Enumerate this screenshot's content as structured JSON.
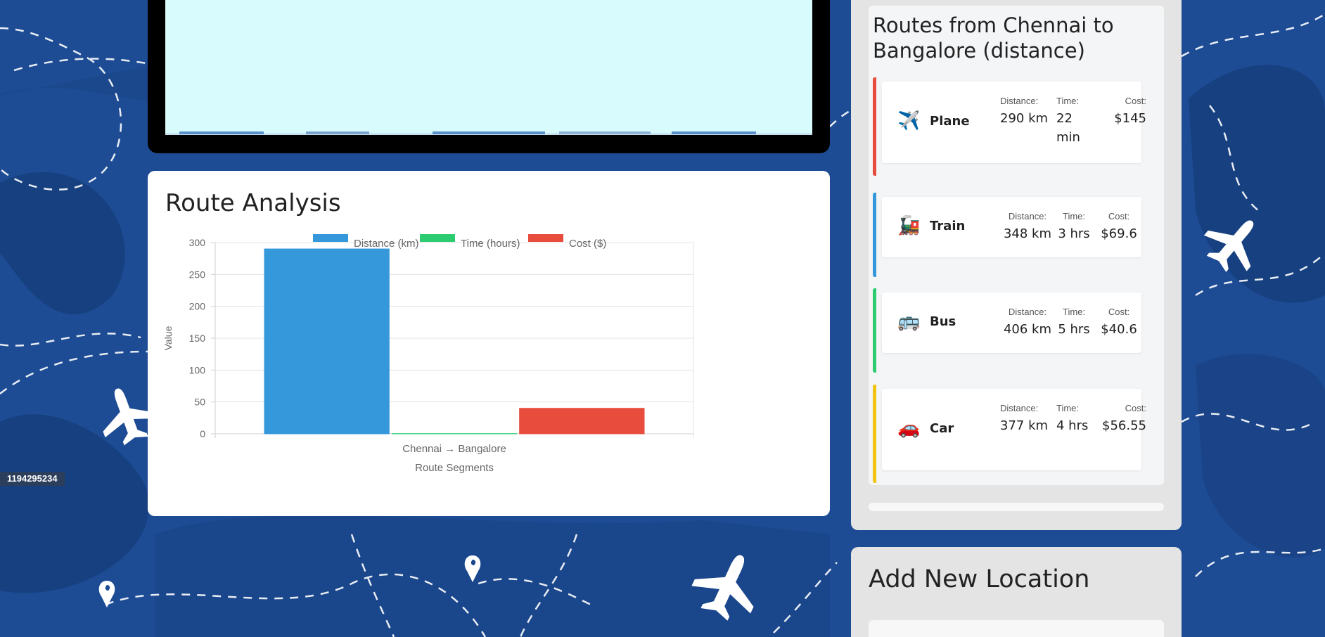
{
  "colors": {
    "background": "#1d4c94",
    "plane": "#e74c3c",
    "train": "#3498db",
    "bus": "#2ecc71",
    "car": "#f1c40f"
  },
  "image_id": "1194295234",
  "analysis": {
    "title": "Route Analysis"
  },
  "chart_data": {
    "type": "bar",
    "categories": [
      "Chennai → Bangalore"
    ],
    "series": [
      {
        "name": "Distance (km)",
        "values": [
          290
        ],
        "color": "#3498db"
      },
      {
        "name": "Time (hours)",
        "values": [
          0.37
        ],
        "color": "#2ecc71"
      },
      {
        "name": "Cost ($)",
        "values": [
          40
        ],
        "color": "#e74c3c"
      }
    ],
    "xlabel": "Route Segments",
    "ylabel": "Value",
    "ylim": [
      0,
      300
    ],
    "yticks": [
      0,
      50,
      100,
      150,
      200,
      250,
      300
    ],
    "grid": true,
    "legend": "top"
  },
  "routes": {
    "title": "Routes from Chennai to Bangalore (distance)",
    "distance_label": "Distance:",
    "time_label": "Time:",
    "cost_label": "Cost:",
    "items": [
      {
        "mode": "Plane",
        "icon": "airplane-icon",
        "glyph": "✈️",
        "distance": "290 km",
        "time": "22 min",
        "cost": "$145"
      },
      {
        "mode": "Train",
        "icon": "train-icon",
        "glyph": "🚂",
        "distance": "348 km",
        "time": "3 hrs",
        "cost": "$69.6"
      },
      {
        "mode": "Bus",
        "icon": "bus-icon",
        "glyph": "🚌",
        "distance": "406 km",
        "time": "5 hrs",
        "cost": "$40.6"
      },
      {
        "mode": "Car",
        "icon": "car-icon",
        "glyph": "🚗",
        "distance": "377 km",
        "time": "4 hrs",
        "cost": "$56.55"
      }
    ]
  },
  "add_location": {
    "title": "Add New Location"
  }
}
